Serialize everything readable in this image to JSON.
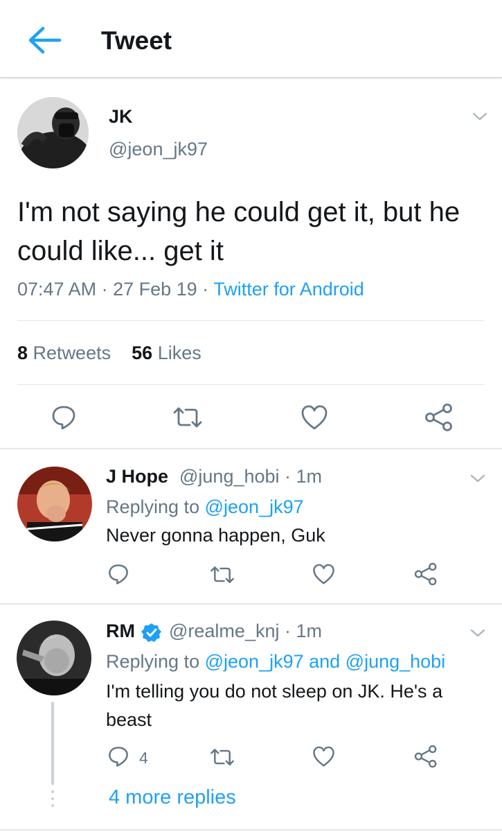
{
  "header": {
    "title": "Tweet",
    "back_icon": "arrow-left-icon"
  },
  "main_tweet": {
    "name": "JK",
    "handle": "@jeon_jk97",
    "text": "I'm not saying he could get it, but he could like... get it",
    "time": "07:47 AM",
    "date": "27 Feb 19",
    "source": "Twitter for Android",
    "retweets_count": "8",
    "retweets_label": "Retweets",
    "likes_count": "56",
    "likes_label": "Likes"
  },
  "replies": [
    {
      "name": "J Hope",
      "handle": "@jung_hobi",
      "age": "1m",
      "replying_prefix": "Replying to",
      "replying_to": "@jeon_jk97",
      "text": "Never gonna happen, Guk"
    },
    {
      "name": "RM",
      "verified": true,
      "handle": "@realme_knj",
      "age": "1m",
      "replying_prefix": "Replying to",
      "replying_to": "@jeon_jk97 and @jung_hobi",
      "text": "I'm telling you do not sleep on JK. He's a beast",
      "reply_count": "4",
      "more_replies": "4 more replies"
    }
  ],
  "colors": {
    "accent": "#1da1f2",
    "secondary_text": "#657786",
    "text": "#14171a",
    "divider": "#e1e8ed"
  }
}
